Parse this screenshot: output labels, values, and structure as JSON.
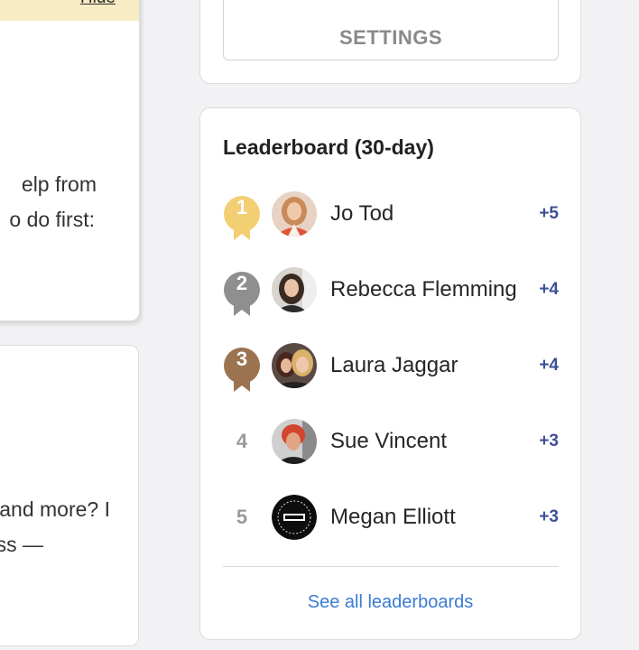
{
  "left_panel": {
    "banner_link": "Hide",
    "card1_lines": [
      "elp from",
      "o do first:"
    ],
    "card2_lines": [
      "and more? I",
      "ss —"
    ]
  },
  "settings": {
    "button_label": "SETTINGS"
  },
  "leaderboard": {
    "title": "Leaderboard (30-day)",
    "entries": [
      {
        "rank": "1",
        "name": "Jo Tod",
        "points": "+5",
        "badge_color": "#f2cf72",
        "avatar_icon": "avatar-photo"
      },
      {
        "rank": "2",
        "name": "Rebecca Flemming",
        "points": "+4",
        "badge_color": "#8f8f8f",
        "avatar_icon": "avatar-photo"
      },
      {
        "rank": "3",
        "name": "Laura Jaggar",
        "points": "+4",
        "badge_color": "#9c7350",
        "avatar_icon": "avatar-photo"
      },
      {
        "rank": "4",
        "name": "Sue Vincent",
        "points": "+3",
        "badge_color": "",
        "avatar_icon": "avatar-photo"
      },
      {
        "rank": "5",
        "name": "Megan Elliott",
        "points": "+3",
        "badge_color": "",
        "avatar_icon": "avatar-logo"
      }
    ],
    "see_all_label": "See all leaderboards"
  },
  "colors": {
    "points": "#3d4f96",
    "link": "#3b7bd4",
    "banner": "#f7ecc4",
    "page_bg": "#f2f2f4"
  }
}
